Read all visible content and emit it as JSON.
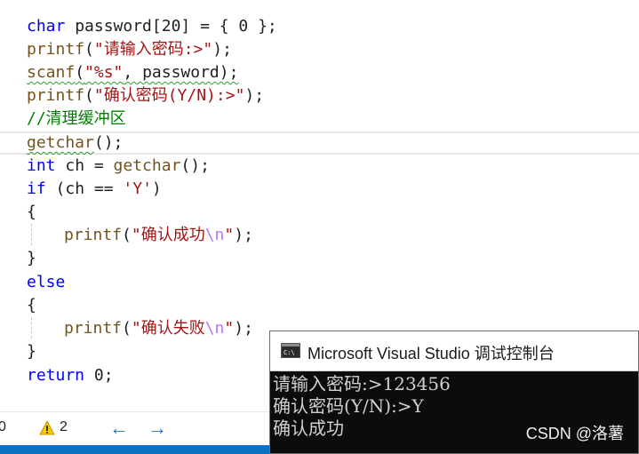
{
  "code": {
    "lines": [
      {
        "t1": "char",
        "t2": " password[20] = { 0 };"
      },
      {
        "fn": "printf",
        "p1": "(",
        "s": "\"请输入密码:>\"",
        "p2": ");"
      },
      {
        "fn": "scanf",
        "p1": "(",
        "s": "\"%s\"",
        "p2": ", password);"
      },
      {
        "fn": "printf",
        "p1": "(",
        "s": "\"确认密码(Y/N):>\"",
        "p2": ");"
      },
      {
        "cmt": "//清理缓冲区"
      },
      {
        "fn": "getchar",
        "p2": "();"
      },
      {
        "kw": "int",
        "rest": " ch = ",
        "fn": "getchar",
        "p2": "();"
      },
      {
        "kw": "if",
        "rest": " (ch == ",
        "s": "'Y'",
        "p2": ")"
      },
      {
        "p": "{"
      },
      {
        "fn": "printf",
        "p1": "(",
        "s": "\"确认成功",
        "esc": "\\n",
        "s2": "\"",
        "p2": ");"
      },
      {
        "p": "}"
      },
      {
        "kw": "else"
      },
      {
        "p": "{"
      },
      {
        "fn": "printf",
        "p1": "(",
        "s": "\"确认失败",
        "esc": "\\n",
        "s2": "\"",
        "p2": ");"
      },
      {
        "p": "}"
      },
      {
        "kw": "return",
        "rest": " 0;"
      }
    ]
  },
  "statusbar": {
    "errors": "0",
    "warnings": "2"
  },
  "console": {
    "title": "Microsoft Visual Studio 调试控制台",
    "lines": [
      "请输入密码:>123456",
      "确认密码(Y/N):>Y",
      "确认成功"
    ]
  },
  "watermark": "CSDN @洛薯",
  "colors": {
    "keyword": "#0000ff",
    "function": "#74531f",
    "string": "#a31515",
    "comment": "#008000",
    "escape": "#b776fb",
    "accent": "#0e70c0"
  }
}
